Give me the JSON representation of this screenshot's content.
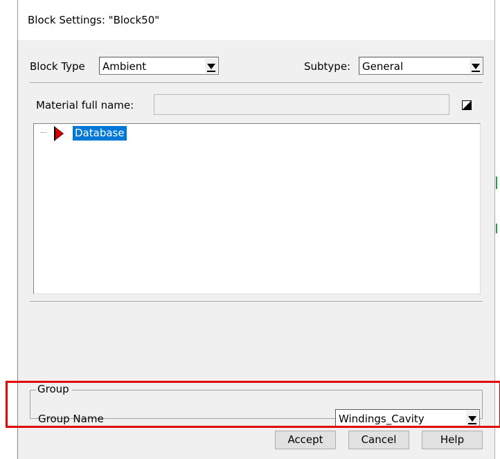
{
  "window": {
    "title": "Block Settings: \"Block50\""
  },
  "block_type": {
    "label": "Block Type",
    "value": "Ambient"
  },
  "subtype": {
    "label": "Subtype:",
    "value": "General"
  },
  "material": {
    "label": "Material full name:",
    "value": ""
  },
  "tree": {
    "items": [
      {
        "label": "Database",
        "selected": true
      }
    ]
  },
  "group": {
    "legend": "Group",
    "name_label": "Group Name",
    "name_value": "Windings_Cavity"
  },
  "buttons": {
    "accept": "Accept",
    "cancel": "Cancel",
    "help": "Help"
  },
  "colors": {
    "selection": "#0078d7",
    "highlight_box": "#e00000",
    "tree_arrow": "#d00000"
  }
}
